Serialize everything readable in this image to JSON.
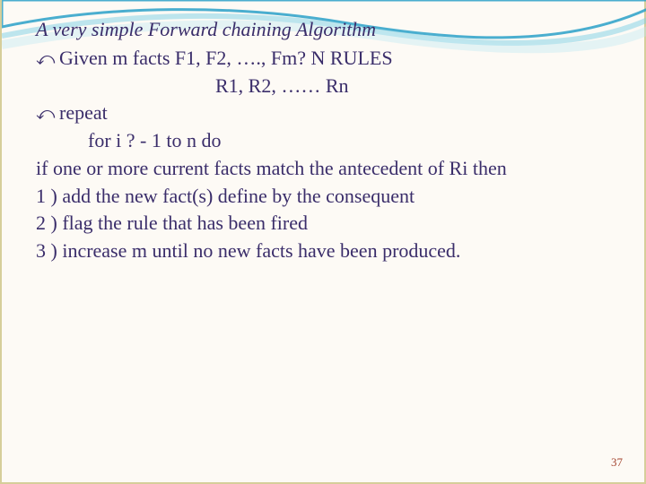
{
  "slide": {
    "title": "A very simple Forward chaining Algorithm",
    "bullet_glyph": "⤺",
    "lines": {
      "given": "Given m facts F1, F2, …., Fm? N RULES",
      "rules": "R1, R2, …… Rn",
      "repeat": "repeat",
      "for": "for i ? - 1 to n do",
      "ifmatch": "if one or more current facts match the antecedent of Ri then",
      "step1": "1 ) add the new fact(s) define by the consequent",
      "step2": "2 ) flag the rule that has been fired",
      "step3": "3 ) increase m until no new facts have been produced."
    },
    "page_number": "37"
  }
}
